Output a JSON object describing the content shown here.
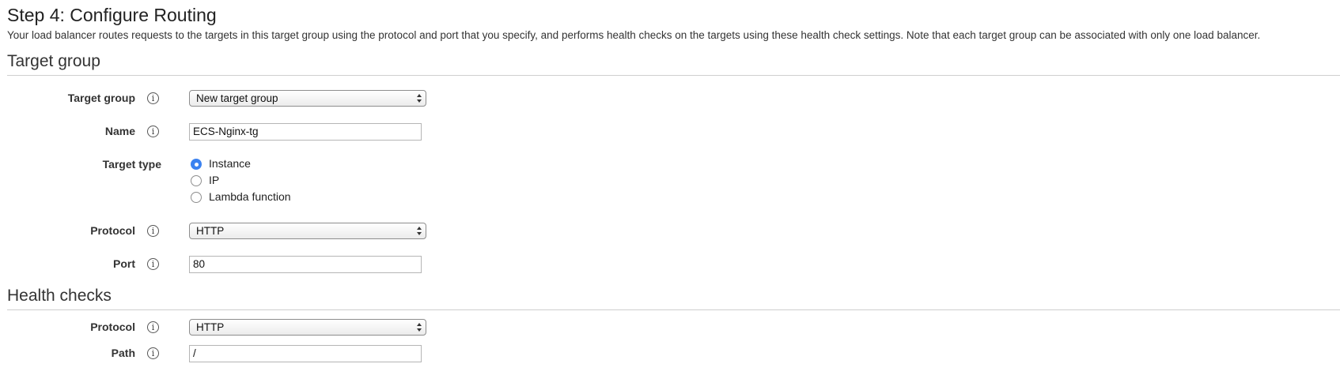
{
  "page": {
    "title": "Step 4: Configure Routing",
    "description": "Your load balancer routes requests to the targets in this target group using the protocol and port that you specify, and performs health checks on the targets using these health check settings. Note that each target group can be associated with only one load balancer."
  },
  "target_group_section": {
    "title": "Target group",
    "target_group": {
      "label": "Target group",
      "value": "New target group"
    },
    "name": {
      "label": "Name",
      "value": "ECS-Nginx-tg"
    },
    "target_type": {
      "label": "Target type",
      "options": [
        {
          "label": "Instance",
          "selected": true
        },
        {
          "label": "IP",
          "selected": false
        },
        {
          "label": "Lambda function",
          "selected": false
        }
      ]
    },
    "protocol": {
      "label": "Protocol",
      "value": "HTTP"
    },
    "port": {
      "label": "Port",
      "value": "80"
    }
  },
  "health_checks_section": {
    "title": "Health checks",
    "protocol": {
      "label": "Protocol",
      "value": "HTTP"
    },
    "path": {
      "label": "Path",
      "value": "/"
    }
  },
  "icons": {
    "info": "info-icon",
    "info_glyph": "i",
    "select_arrows": "updown-arrows-icon"
  },
  "colors": {
    "radio_selected": "#3b82f0",
    "section_rule": "#cfcfcf"
  }
}
